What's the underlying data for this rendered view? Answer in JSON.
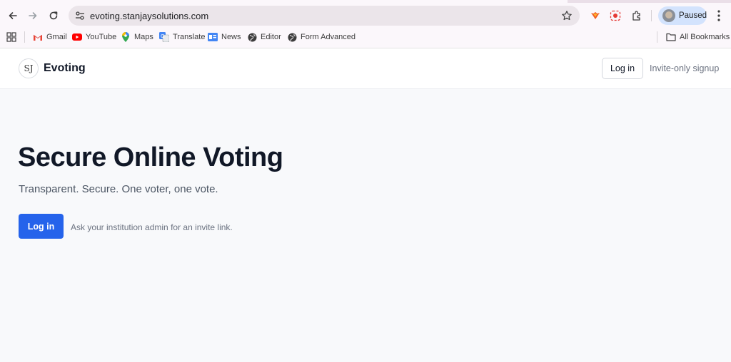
{
  "browser": {
    "url": "evoting.stanjaysolutions.com",
    "profile_label": "Paused",
    "bookmarks": [
      {
        "label": "Gmail",
        "icon": "gmail-icon"
      },
      {
        "label": "YouTube",
        "icon": "youtube-icon"
      },
      {
        "label": "Maps",
        "icon": "maps-icon"
      },
      {
        "label": "Translate",
        "icon": "translate-icon"
      },
      {
        "label": "News",
        "icon": "news-icon"
      },
      {
        "label": "Editor",
        "icon": "globe-icon"
      },
      {
        "label": "Form Advanced",
        "icon": "globe-icon"
      }
    ],
    "all_bookmarks_label": "All Bookmarks"
  },
  "site": {
    "logo_text": "SJ",
    "brand": "Evoting",
    "header_login": "Log in",
    "header_signup": "Invite-only signup"
  },
  "hero": {
    "title": "Secure Online Voting",
    "subtitle": "Transparent. Secure. One voter, one vote.",
    "login_button": "Log in",
    "invite_note": "Ask your institution admin for an invite link."
  },
  "colors": {
    "accent": "#2563eb",
    "heading": "#111827",
    "muted": "#6b7280",
    "page_bg": "#f8f9fb"
  }
}
